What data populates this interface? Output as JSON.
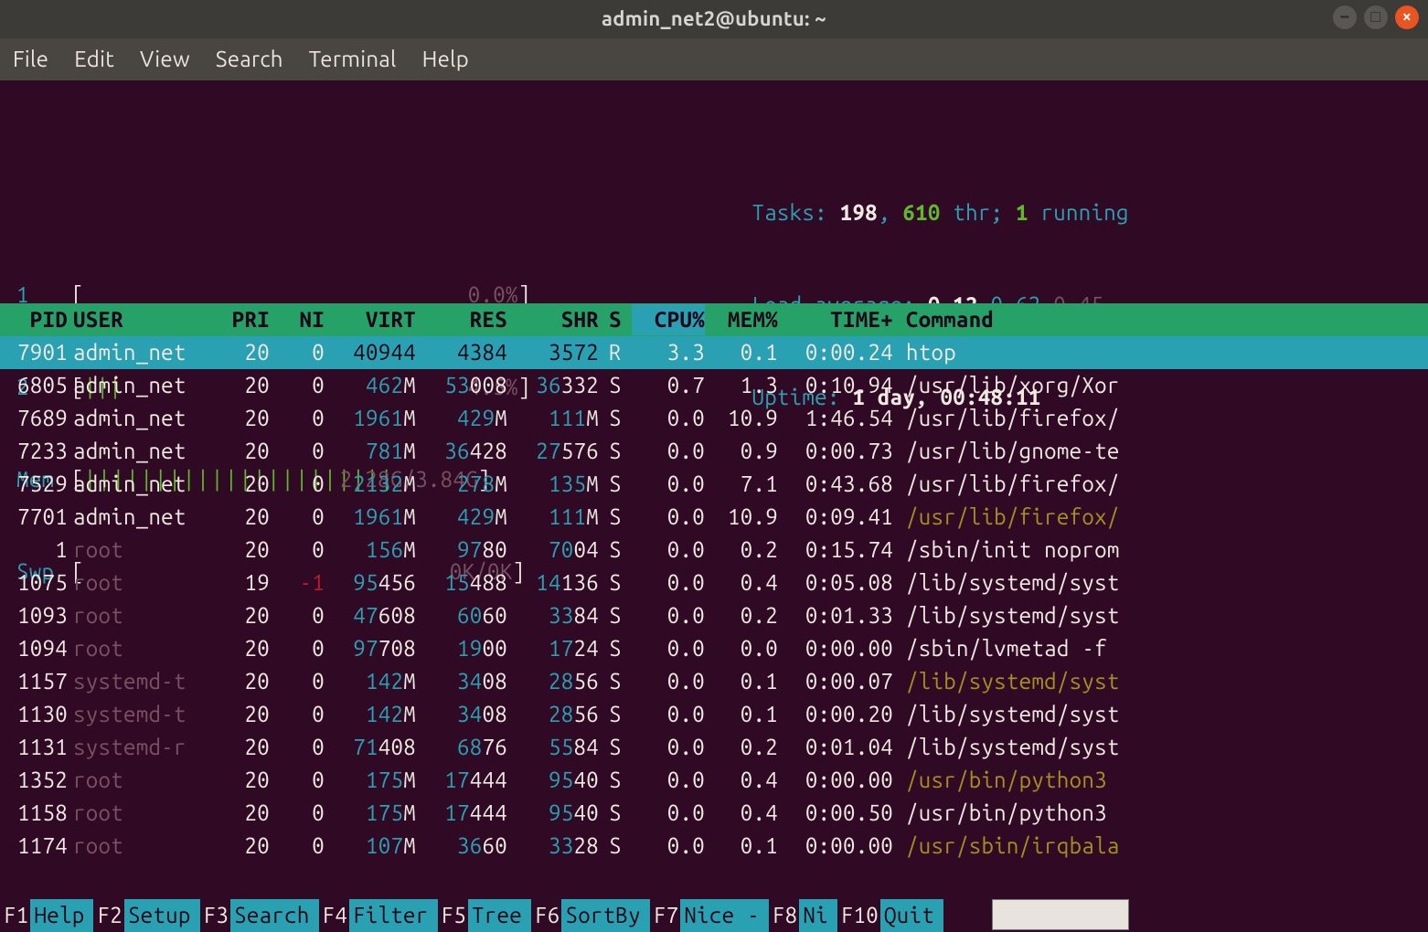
{
  "window": {
    "title": "admin_net2@ubuntu: ~",
    "controls": {
      "minimize": "–",
      "maximize": "□",
      "close": "×"
    }
  },
  "menubar": [
    "File",
    "Edit",
    "View",
    "Search",
    "Terminal",
    "Help"
  ],
  "meters": {
    "cpu1": {
      "label": "1",
      "bar": "",
      "value": "0.0%"
    },
    "cpu2": {
      "label": "2",
      "bar": "|||",
      "value": "4.5%"
    },
    "mem": {
      "label": "Mem",
      "bar": "||||||||||||||||||||||",
      "value": "2.28G/3.84G"
    },
    "swp": {
      "label": "Swp",
      "bar": "",
      "value": "0K/0K"
    }
  },
  "summary": {
    "tasks_label": "Tasks: ",
    "tasks_total": "198",
    "tasks_sep": ", ",
    "tasks_thr": "610",
    "tasks_thr_lbl": " thr; ",
    "tasks_running": "1",
    "tasks_running_lbl": " running",
    "load_label": "Load average: ",
    "load1": "0.12",
    "load5": "0.62",
    "load15": "0.45",
    "uptime_label": "Uptime: ",
    "uptime_value": "1 day, 00:48:11"
  },
  "headers": {
    "pid": "PID",
    "user": "USER",
    "pri": "PRI",
    "ni": "NI",
    "virt": "VIRT",
    "res": "RES",
    "shr": "SHR",
    "s": "S",
    "cpu": "CPU%",
    "mem": "MEM%",
    "time": "TIME+",
    "cmd": "Command"
  },
  "processes": [
    {
      "pid": "7901",
      "user": "admin_net",
      "pri": "20",
      "ni": "0",
      "virt": "40944",
      "res": "4384",
      "shr": "3572",
      "s": "R",
      "cpu": "3.3",
      "mem": "0.1",
      "time": "0:00.24",
      "cmd": "htop",
      "selected": true,
      "user_dim": false,
      "cmd_yellow": false
    },
    {
      "pid": "6805",
      "user": "admin_net",
      "pri": "20",
      "ni": "0",
      "virt": "462M",
      "res": "53008",
      "shr": "36332",
      "s": "S",
      "cpu": "0.7",
      "mem": "1.3",
      "time": "0:10.94",
      "cmd": "/usr/lib/xorg/Xor",
      "user_dim": false,
      "cmd_yellow": false
    },
    {
      "pid": "7689",
      "user": "admin_net",
      "pri": "20",
      "ni": "0",
      "virt": "1961M",
      "res": "429M",
      "shr": "111M",
      "s": "S",
      "cpu": "0.0",
      "mem": "10.9",
      "time": "1:46.54",
      "cmd": "/usr/lib/firefox/",
      "user_dim": false,
      "cmd_yellow": false
    },
    {
      "pid": "7233",
      "user": "admin_net",
      "pri": "20",
      "ni": "0",
      "virt": "781M",
      "res": "36428",
      "shr": "27576",
      "s": "S",
      "cpu": "0.0",
      "mem": "0.9",
      "time": "0:00.73",
      "cmd": "/usr/lib/gnome-te",
      "user_dim": false,
      "cmd_yellow": false
    },
    {
      "pid": "7529",
      "user": "admin_net",
      "pri": "20",
      "ni": "0",
      "virt": "2132M",
      "res": "278M",
      "shr": "135M",
      "s": "S",
      "cpu": "0.0",
      "mem": "7.1",
      "time": "0:43.68",
      "cmd": "/usr/lib/firefox/",
      "user_dim": false,
      "cmd_yellow": false
    },
    {
      "pid": "7701",
      "user": "admin_net",
      "pri": "20",
      "ni": "0",
      "virt": "1961M",
      "res": "429M",
      "shr": "111M",
      "s": "S",
      "cpu": "0.0",
      "mem": "10.9",
      "time": "0:09.41",
      "cmd": "/usr/lib/firefox/",
      "user_dim": false,
      "cmd_yellow": true
    },
    {
      "pid": "1",
      "user": "root",
      "pri": "20",
      "ni": "0",
      "virt": "156M",
      "res": "9780",
      "shr": "7004",
      "s": "S",
      "cpu": "0.0",
      "mem": "0.2",
      "time": "0:15.74",
      "cmd": "/sbin/init noprom",
      "user_dim": true,
      "cmd_yellow": false
    },
    {
      "pid": "1075",
      "user": "root",
      "pri": "19",
      "ni": "-1",
      "virt": "95456",
      "res": "15488",
      "shr": "14136",
      "s": "S",
      "cpu": "0.0",
      "mem": "0.4",
      "time": "0:05.08",
      "cmd": "/lib/systemd/syst",
      "user_dim": true,
      "cmd_yellow": false,
      "ni_red": true
    },
    {
      "pid": "1093",
      "user": "root",
      "pri": "20",
      "ni": "0",
      "virt": "47608",
      "res": "6060",
      "shr": "3384",
      "s": "S",
      "cpu": "0.0",
      "mem": "0.2",
      "time": "0:01.33",
      "cmd": "/lib/systemd/syst",
      "user_dim": true,
      "cmd_yellow": false
    },
    {
      "pid": "1094",
      "user": "root",
      "pri": "20",
      "ni": "0",
      "virt": "97708",
      "res": "1900",
      "shr": "1724",
      "s": "S",
      "cpu": "0.0",
      "mem": "0.0",
      "time": "0:00.00",
      "cmd": "/sbin/lvmetad -f",
      "user_dim": true,
      "cmd_yellow": false
    },
    {
      "pid": "1157",
      "user": "systemd-t",
      "pri": "20",
      "ni": "0",
      "virt": "142M",
      "res": "3408",
      "shr": "2856",
      "s": "S",
      "cpu": "0.0",
      "mem": "0.1",
      "time": "0:00.07",
      "cmd": "/lib/systemd/syst",
      "user_dim": true,
      "cmd_yellow": true
    },
    {
      "pid": "1130",
      "user": "systemd-t",
      "pri": "20",
      "ni": "0",
      "virt": "142M",
      "res": "3408",
      "shr": "2856",
      "s": "S",
      "cpu": "0.0",
      "mem": "0.1",
      "time": "0:00.20",
      "cmd": "/lib/systemd/syst",
      "user_dim": true,
      "cmd_yellow": false
    },
    {
      "pid": "1131",
      "user": "systemd-r",
      "pri": "20",
      "ni": "0",
      "virt": "71408",
      "res": "6876",
      "shr": "5584",
      "s": "S",
      "cpu": "0.0",
      "mem": "0.2",
      "time": "0:01.04",
      "cmd": "/lib/systemd/syst",
      "user_dim": true,
      "cmd_yellow": false
    },
    {
      "pid": "1352",
      "user": "root",
      "pri": "20",
      "ni": "0",
      "virt": "175M",
      "res": "17444",
      "shr": "9540",
      "s": "S",
      "cpu": "0.0",
      "mem": "0.4",
      "time": "0:00.00",
      "cmd": "/usr/bin/python3",
      "user_dim": true,
      "cmd_yellow": true
    },
    {
      "pid": "1158",
      "user": "root",
      "pri": "20",
      "ni": "0",
      "virt": "175M",
      "res": "17444",
      "shr": "9540",
      "s": "S",
      "cpu": "0.0",
      "mem": "0.4",
      "time": "0:00.50",
      "cmd": "/usr/bin/python3",
      "user_dim": true,
      "cmd_yellow": false
    },
    {
      "pid": "1174",
      "user": "root",
      "pri": "20",
      "ni": "0",
      "virt": "107M",
      "res": "3660",
      "shr": "3328",
      "s": "S",
      "cpu": "0.0",
      "mem": "0.1",
      "time": "0:00.00",
      "cmd": "/usr/sbin/irqbala",
      "user_dim": true,
      "cmd_yellow": true
    }
  ],
  "fkeys": [
    {
      "k": "F1",
      "lbl": "Help"
    },
    {
      "k": "F2",
      "lbl": "Setup"
    },
    {
      "k": "F3",
      "lbl": "Search"
    },
    {
      "k": "F4",
      "lbl": "Filter"
    },
    {
      "k": "F5",
      "lbl": "Tree"
    },
    {
      "k": "F6",
      "lbl": "SortBy"
    },
    {
      "k": "F7",
      "lbl": "Nice -"
    },
    {
      "k": "F8",
      "lbl": "Ni"
    },
    {
      "k": "F10",
      "lbl": "Quit"
    }
  ]
}
